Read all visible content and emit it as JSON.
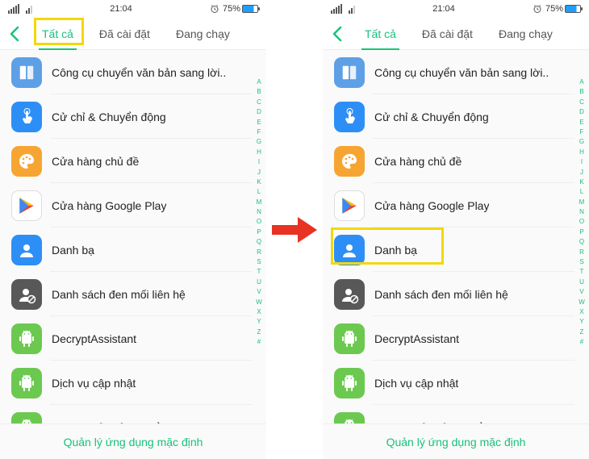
{
  "status": {
    "signal_text": "",
    "time": "21:04",
    "alarm_icon": "alarm",
    "battery_pct": "75%"
  },
  "tabs": {
    "back_icon": "chevron-left",
    "items": [
      "Tất cả",
      "Đã cài đặt",
      "Đang chạy"
    ],
    "active_index": 0
  },
  "apps": [
    {
      "label": "Công cụ chuyển văn bản sang lời..",
      "icon": "tts",
      "color": "ic-lightblue"
    },
    {
      "label": "Cử chỉ & Chuyển động",
      "icon": "touch",
      "color": "ic-blue"
    },
    {
      "label": "Cửa hàng chủ đề",
      "icon": "palette",
      "color": "ic-orange"
    },
    {
      "label": "Cửa hàng Google Play",
      "icon": "play",
      "color": "ic-white"
    },
    {
      "label": "Danh bạ",
      "icon": "contact",
      "color": "ic-blue"
    },
    {
      "label": "Danh sách đen mối liên hệ",
      "icon": "contact-block",
      "color": "ic-dark"
    },
    {
      "label": "DecryptAssistant",
      "icon": "android",
      "color": "ic-green"
    },
    {
      "label": "Dịch vụ cập nhật",
      "icon": "android",
      "color": "ic-green"
    },
    {
      "label": "Dịch vụ cử chỉ_chuyển động",
      "icon": "android",
      "color": "ic-green"
    }
  ],
  "index_letters": [
    "A",
    "B",
    "C",
    "D",
    "E",
    "F",
    "G",
    "H",
    "I",
    "J",
    "K",
    "L",
    "M",
    "N",
    "O",
    "P",
    "Q",
    "R",
    "S",
    "T",
    "U",
    "V",
    "W",
    "X",
    "Y",
    "Z",
    "#"
  ],
  "footer": {
    "label": "Quản lý ứng dụng mặc định"
  },
  "highlights": {
    "left": {
      "target": "tab-0"
    },
    "right": {
      "target": "app-4"
    }
  },
  "arrow_color": "#e83223"
}
